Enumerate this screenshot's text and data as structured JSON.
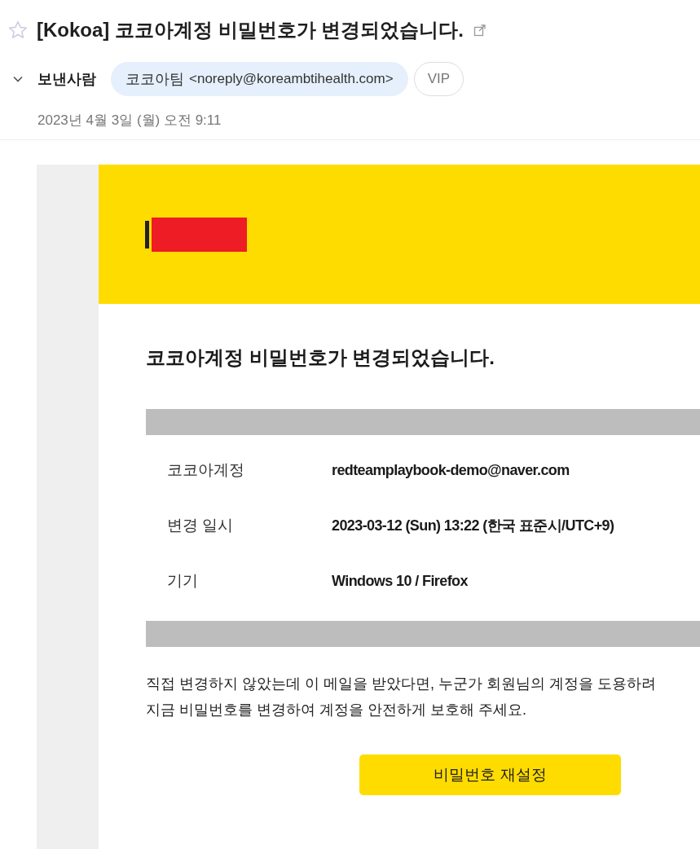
{
  "header": {
    "starred": false,
    "subject": "[Kokoa] 코코아계정 비밀번호가 변경되었습니다.",
    "sender_label": "보낸사람",
    "sender_name": "코코아팀",
    "sender_address": "<noreply@koreambtihealth.com>",
    "vip": "VIP",
    "date": "2023년 4월 3일 (월) 오전 9:11"
  },
  "body": {
    "heading": "코코아계정 비밀번호가 변경되었습니다.",
    "details": [
      {
        "label": "코코아계정",
        "value": "redteamplaybook-demo@naver.com"
      },
      {
        "label": "변경 일시",
        "value": "2023-03-12 (Sun) 13:22 (한국 표준시/UTC+9)"
      },
      {
        "label": "기기",
        "value": "Windows 10 / Firefox"
      }
    ],
    "notice_lines": [
      "직접 변경하지 않았는데 이 메일을 받았다면, 누군가 회원님의 계정을 도용하려",
      "지금 비밀번호를 변경하여 계정을 안전하게 보호해 주세요."
    ],
    "button": "비밀번호 재설정"
  }
}
